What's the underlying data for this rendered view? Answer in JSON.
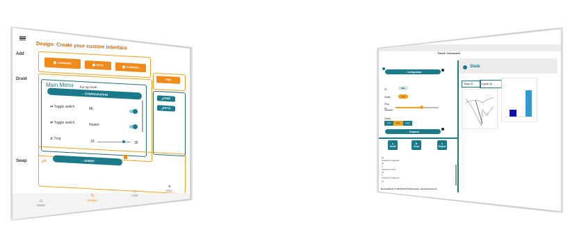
{
  "left": {
    "title": "Design: Create your custom interface",
    "sections": {
      "add": "Add",
      "druid": "Druid",
      "swap": "Swap"
    },
    "add_buttons": [
      "COMMAND",
      "INPUT",
      "SUBMENU"
    ],
    "time_button": "TIME",
    "main_menu": {
      "title": "Main Menu",
      "subtitle": "the top level...",
      "config_button": "CONFIGURATION"
    },
    "rows": [
      {
        "kind": "Toggle switch",
        "value": "ML"
      },
      {
        "kind": "Toggle switch",
        "value": "Heater"
      }
    ],
    "temp": {
      "label": "Tmp",
      "min": "18",
      "max": "35"
    },
    "side_buttons": [
      "TEMP",
      "FIFTH"
    ],
    "swap_button": "SUBMIT",
    "nav": [
      "Home",
      "Design",
      "Link",
      "Misc"
    ]
  },
  "right": {
    "status": "Druid: Connected",
    "config_button": "Configuration",
    "fields": {
      "f1": "Fil",
      "f1_value": "Bits",
      "f2": "Stable",
      "f2_value": "Yes",
      "f3": "Ring",
      "f3_value": "40"
    },
    "speed": {
      "label": "Speed",
      "options": [
        "Low",
        "Med",
        "High"
      ],
      "selected": "Med"
    },
    "snapshot_button": "Snapshot",
    "action_buttons": [
      "Scroll",
      "Clear",
      "Export"
    ],
    "console": [
      "uk",
      "Snapshot triggered",
      "ok",
      "3",
      "Speed is now 2",
      "ok",
      "1",
      "Snapshot triggered",
      "ok"
    ],
    "footer": "RemoteDruid © 2015-2017 Pat Designs, devicedruid.com",
    "state": {
      "title": "State",
      "temp_label": "Temp",
      "temp_value": "33",
      "cycle_label": "Cycle",
      "cycle_value": "11"
    },
    "colors": {
      "accent": "#1a7a8a",
      "orange": "#f08a1a",
      "bar1": "#1010b0",
      "bar2": "#3399cc"
    }
  }
}
